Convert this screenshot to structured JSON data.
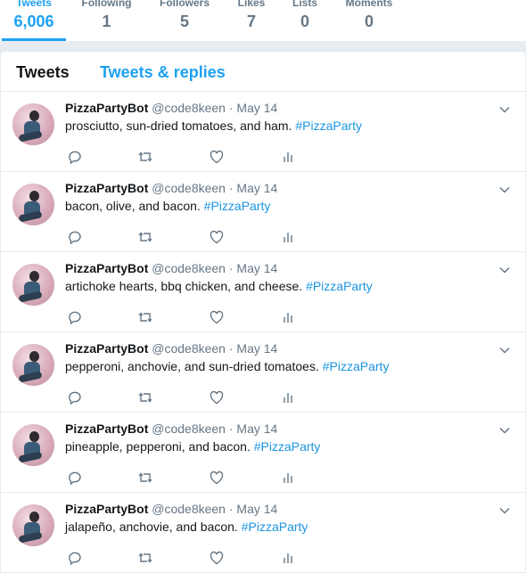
{
  "profile_nav": {
    "stats": [
      {
        "label": "Tweets",
        "value": "6,006",
        "active": true
      },
      {
        "label": "Following",
        "value": "1"
      },
      {
        "label": "Followers",
        "value": "5"
      },
      {
        "label": "Likes",
        "value": "7"
      },
      {
        "label": "Lists",
        "value": "0"
      },
      {
        "label": "Moments",
        "value": "0"
      }
    ]
  },
  "timeline": {
    "tabs": [
      "Tweets",
      "Tweets & replies"
    ],
    "active_tab": "Tweets",
    "tweets": [
      {
        "name": "PizzaPartyBot",
        "handle": "@code8keen",
        "separator": "·",
        "time": "May 14",
        "text": "prosciutto, sun-dried tomatoes, and ham.",
        "hashtag": "#PizzaParty"
      },
      {
        "name": "PizzaPartyBot",
        "handle": "@code8keen",
        "separator": "·",
        "time": "May 14",
        "text": "bacon, olive, and bacon.",
        "hashtag": "#PizzaParty"
      },
      {
        "name": "PizzaPartyBot",
        "handle": "@code8keen",
        "separator": "·",
        "time": "May 14",
        "text": "artichoke hearts, bbq chicken, and cheese.",
        "hashtag": "#PizzaParty"
      },
      {
        "name": "PizzaPartyBot",
        "handle": "@code8keen",
        "separator": "·",
        "time": "May 14",
        "text": "pepperoni, anchovie, and sun-dried tomatoes.",
        "hashtag": "#PizzaParty"
      },
      {
        "name": "PizzaPartyBot",
        "handle": "@code8keen",
        "separator": "·",
        "time": "May 14",
        "text": "pineapple, pepperoni, and bacon.",
        "hashtag": "#PizzaParty"
      },
      {
        "name": "PizzaPartyBot",
        "handle": "@code8keen",
        "separator": "·",
        "time": "May 14",
        "text": "jalapeño, anchovie, and bacon.",
        "hashtag": "#PizzaParty"
      }
    ],
    "icons": [
      "reply-icon",
      "retweet-icon",
      "like-icon",
      "analytics-icon",
      "chevron-down-icon"
    ]
  },
  "colors": {
    "accent": "#1da1f2",
    "hashtag": "#1b95e0",
    "muted": "#657786",
    "text": "#14171a",
    "border": "#e6ecf0"
  }
}
